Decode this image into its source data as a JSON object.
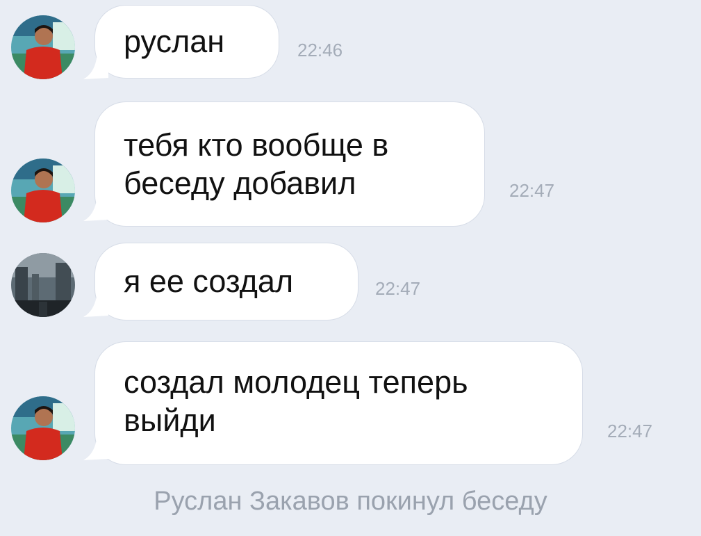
{
  "messages": [
    {
      "text": "руслан",
      "time": "22:46",
      "avatar": "boy-red-shirt-avatar"
    },
    {
      "text": "тебя кто вообще в беседу добавил",
      "time": "22:47",
      "avatar": "boy-red-shirt-avatar"
    },
    {
      "text": "я ее создал",
      "time": "22:47",
      "avatar": "dark-street-avatar"
    },
    {
      "text": "создал молодец теперь выйди",
      "time": "22:47",
      "avatar": "boy-red-shirt-avatar"
    }
  ],
  "system": {
    "left_note": "Руслан Закавов покинул беседу"
  },
  "colors": {
    "background": "#e9edf4",
    "bubble": "#ffffff",
    "timestamp": "#a4acb8",
    "system_text": "#9aa2ae"
  }
}
